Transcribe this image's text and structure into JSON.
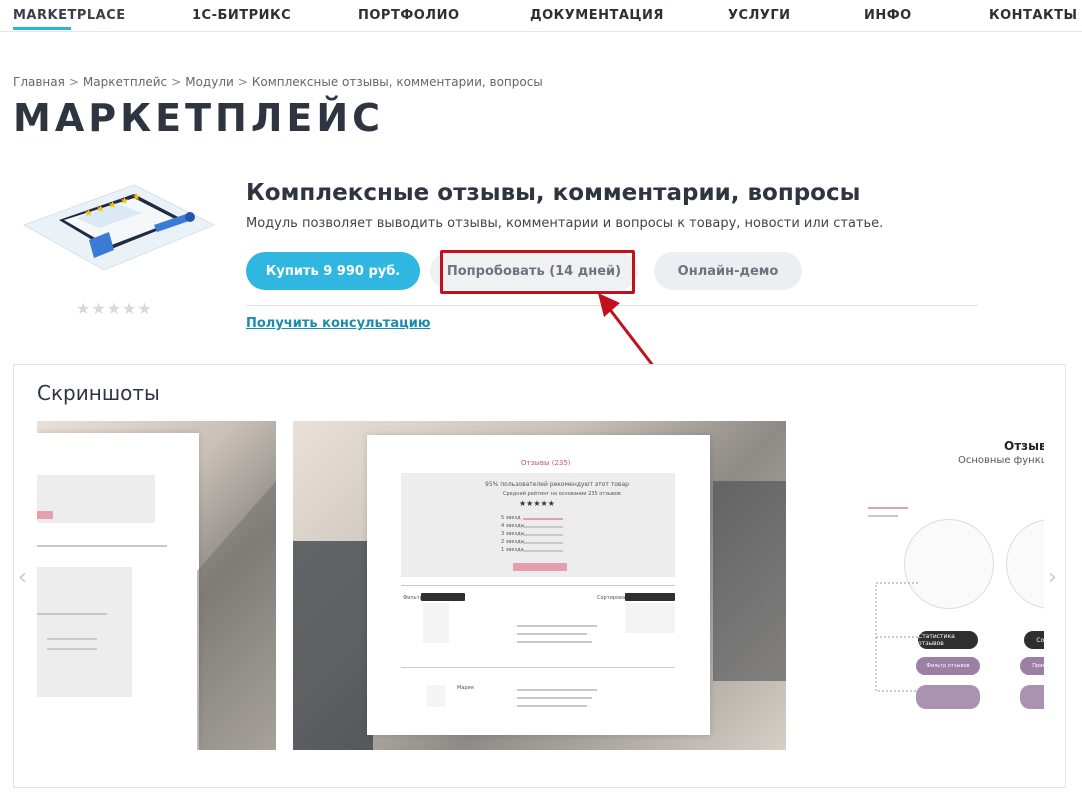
{
  "nav": {
    "items": [
      {
        "label": "MARKETPLACE"
      },
      {
        "label": "1С-БИТРИКС"
      },
      {
        "label": "ПОРТФОЛИО"
      },
      {
        "label": "ДОКУМЕНТАЦИЯ"
      },
      {
        "label": "УСЛУГИ"
      },
      {
        "label": "ИНФО"
      },
      {
        "label": "КОНТАКТЫ"
      }
    ],
    "active_index": 0,
    "accent_color": "#29b6d9"
  },
  "breadcrumb": [
    "Главная",
    "Маркетплейс",
    "Модули",
    "Комплексные отзывы, комментарии, вопросы"
  ],
  "breadcrumb_separator": ">",
  "page_title": "МАРКЕТПЛЕЙС",
  "product": {
    "title": "Комплексные отзывы, комментарии, вопросы",
    "description": "Модуль позволяет выводить отзывы, комментарии и вопросы к товару, новости или статье.",
    "rating_stars": "★★★★★",
    "rating_value": 0,
    "buttons": {
      "buy": "Купить 9 990 руб.",
      "try": "Попробовать (14 дней)",
      "demo": "Онлайн-демо"
    },
    "consult_link": "Получить консультацию",
    "highlight_color": "#c0111c"
  },
  "screenshots": {
    "title": "Скриншоты",
    "shot_b": {
      "heading": "Отзывы (235)",
      "recommend": "95% пользователей рекомендуют этот товар",
      "rating_label": "Средний рейтинг на основании 235 отзывов",
      "stars": "★★★★★",
      "rows": [
        "5 звезд",
        "4 звезды",
        "3 звезды",
        "2 звезды",
        "1 звезда"
      ],
      "filter": "Фильтр",
      "sort": "Сортировать по:",
      "author": "Мария"
    },
    "shot_c": {
      "title": "Отзывы",
      "subtitle": "Основные функции",
      "chip_dark_1": "Статистика отзывов",
      "chip_purple_1": "Фильтр отзывов",
      "chip_dark_2": "Сорт",
      "chip_purple_2": "Прикре"
    },
    "prev_arrow": "‹",
    "next_arrow": "›"
  }
}
